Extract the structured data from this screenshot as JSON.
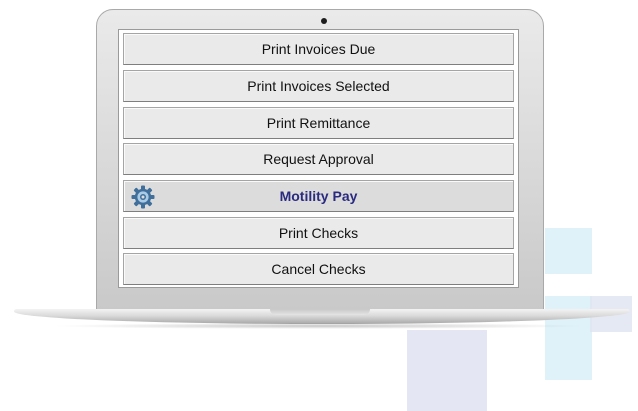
{
  "menu": {
    "items": [
      {
        "label": "Print Invoices Due"
      },
      {
        "label": "Print Invoices Selected"
      },
      {
        "label": "Print Remittance"
      },
      {
        "label": "Request Approval"
      },
      {
        "label": "Motility Pay",
        "icon": "gear-icon",
        "highlighted": true
      },
      {
        "label": "Print Checks"
      },
      {
        "label": "Cancel Checks"
      }
    ]
  },
  "colors": {
    "highlight_text": "#2a2a80",
    "gear_icon": "#3f6f9a",
    "button_bg": "#eaeaea",
    "accent_light": "#d5eef7"
  }
}
